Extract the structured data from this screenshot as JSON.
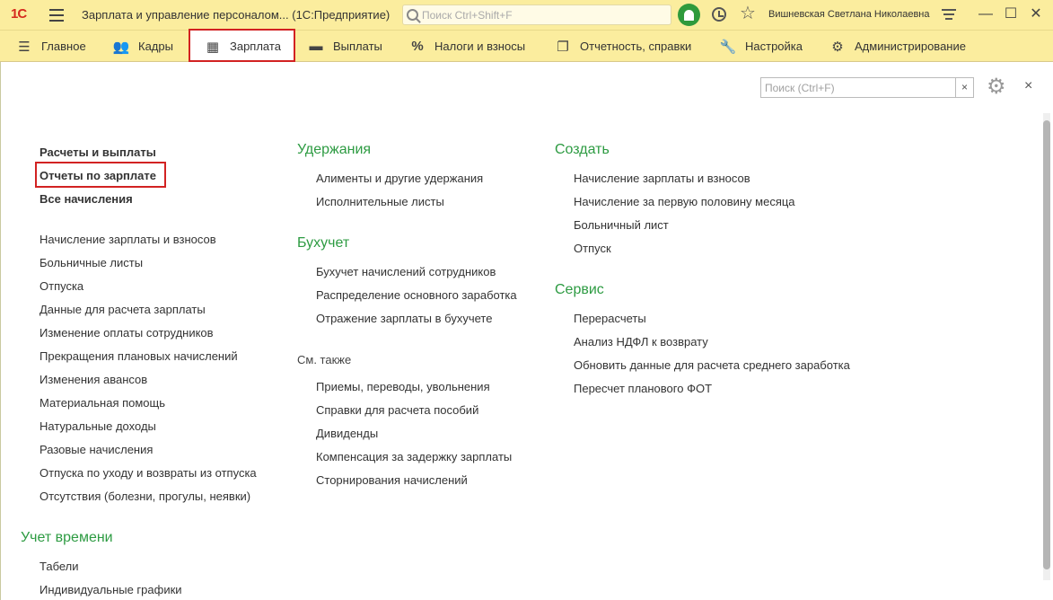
{
  "titlebar": {
    "logo": "1С",
    "title": "Зарплата и управление персоналом...  (1С:Предприятие)",
    "search_placeholder": "Поиск Ctrl+Shift+F",
    "user": "Вишневская Светлана Николаевна"
  },
  "menu": [
    {
      "label": "Главное",
      "icon": "hamburger-icon"
    },
    {
      "label": "Кадры",
      "icon": "people-icon"
    },
    {
      "label": "Зарплата",
      "icon": "calculator-icon"
    },
    {
      "label": "Выплаты",
      "icon": "wallet-icon"
    },
    {
      "label": "Налоги и взносы",
      "icon": "percent-icon"
    },
    {
      "label": "Отчетность, справки",
      "icon": "documents-icon"
    },
    {
      "label": "Настройка",
      "icon": "wrench-icon"
    },
    {
      "label": "Администрирование",
      "icon": "gear-icon"
    }
  ],
  "panel": {
    "search_placeholder": "Поиск (Ctrl+F)"
  },
  "col1": {
    "bold_links": [
      "Расчеты и выплаты",
      "Отчеты по зарплате",
      "Все начисления"
    ],
    "links": [
      "Начисление зарплаты и взносов",
      "Больничные листы",
      "Отпуска",
      "Данные для расчета зарплаты",
      "Изменение оплаты сотрудников",
      "Прекращения плановых начислений",
      "Изменения авансов",
      "Материальная помощь",
      "Натуральные доходы",
      "Разовые начисления",
      "Отпуска по уходу и возвраты из отпуска",
      "Отсутствия (болезни, прогулы, неявки)"
    ],
    "time_section": "Учет времени",
    "time_links": [
      "Табели",
      "Индивидуальные графики"
    ]
  },
  "col2": {
    "deductions_title": "Удержания",
    "deductions": [
      "Алименты и другие удержания",
      "Исполнительные листы"
    ],
    "accounting_title": "Бухучет",
    "accounting": [
      "Бухучет начислений сотрудников",
      "Распределение основного заработка",
      "Отражение зарплаты в бухучете"
    ],
    "see_also_title": "См. также",
    "see_also": [
      "Приемы, переводы, увольнения",
      "Справки для расчета пособий",
      "Дивиденды",
      "Компенсация за задержку зарплаты",
      "Сторнирования начислений"
    ]
  },
  "col3": {
    "create_title": "Создать",
    "create": [
      "Начисление зарплаты и взносов",
      "Начисление за первую половину месяца",
      "Больничный лист",
      "Отпуск"
    ],
    "service_title": "Сервис",
    "service": [
      "Перерасчеты",
      "Анализ НДФЛ к возврату",
      "Обновить данные для расчета среднего заработка",
      "Пересчет планового ФОТ"
    ]
  },
  "colors": {
    "bar": "#fbed9e",
    "section": "#2d9b42",
    "highlight": "#d22222"
  }
}
